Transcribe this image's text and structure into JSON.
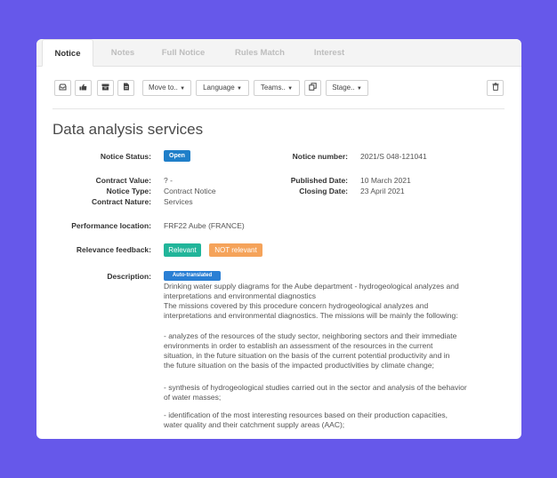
{
  "tabs": [
    "Notice",
    "Notes",
    "Full Notice",
    "Rules Match",
    "Interest"
  ],
  "toolbar": {
    "move_to": "Move to..",
    "language": "Language",
    "teams": "Teams..",
    "stage": "Stage.."
  },
  "notice": {
    "title": "Data analysis services",
    "status_label": "Notice Status:",
    "status_value": "Open",
    "number_label": "Notice number:",
    "number_value": "2021/S 048-121041",
    "contract_value_label": "Contract Value:",
    "contract_value": "? -",
    "notice_type_label": "Notice Type:",
    "notice_type": "Contract Notice",
    "contract_nature_label": "Contract Nature:",
    "contract_nature": "Services",
    "published_label": "Published Date:",
    "published_value": "10 March 2021",
    "closing_label": "Closing Date:",
    "closing_value": "23 April 2021",
    "performance_label": "Performance location:",
    "performance_value": "FRF22 Aube (FRANCE)",
    "relevance_label": "Relevance feedback:",
    "relevant_btn": "Relevant",
    "not_relevant_btn": "NOT relevant",
    "description_label": "Description:",
    "auto_translated": "Auto-translated",
    "description_lines": [
      "Drinking water supply diagrams for the Aube department - hydrogeological analyzes and",
      "interpretations and environmental diagnostics",
      "The missions covered by this procedure concern hydrogeological analyzes and",
      "interpretations and environmental diagnostics. The missions will be mainly the following:",
      "- analyzes of the resources of the study sector, neighboring sectors and their immediate",
      "environments in order to establish an assessment of the resources in the current",
      "situation, in the future situation on the basis of the current potential productivity and in",
      "the future situation on the basis of the impacted productivities by climate change;",
      "- synthesis of hydrogeological studies carried out in the sector and analysis of the behavior",
      "of water masses;",
      "- identification of the most interesting resources based on their production capacities,",
      "water quality and their catchment supply areas (AAC);"
    ]
  },
  "colors": {
    "background": "#6658ea",
    "status_badge": "#1f7fc9",
    "relevant": "#21b59a",
    "not_relevant": "#f5a35a",
    "auto_translated": "#2a7fd4"
  }
}
